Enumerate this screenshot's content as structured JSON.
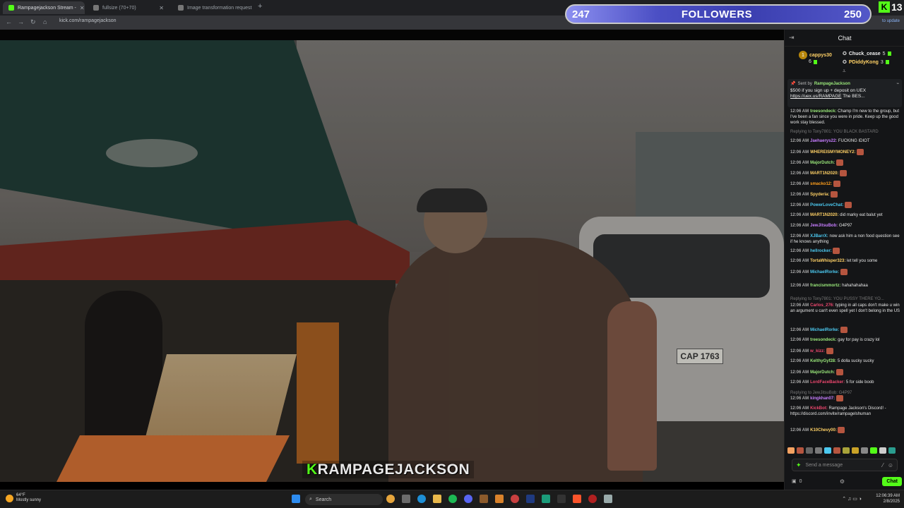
{
  "browser": {
    "tabs": [
      {
        "label": "Rampagejackson Stream - ",
        "active": true,
        "color": "#53fc18"
      },
      {
        "label": "fullsize (70+70)",
        "active": false,
        "color": "#777777"
      },
      {
        "label": "Image transformation request",
        "active": false,
        "color": "#777777"
      }
    ],
    "url": "kick.com/rampagejackson",
    "update_label": "to update"
  },
  "overlay": {
    "followers_left": "247",
    "followers_label": "FOLLOWERS",
    "followers_right": "250",
    "kick_count": "13",
    "watermark_k": "K",
    "watermark_name": "RAMPAGEJACKSON"
  },
  "chat": {
    "title": "Chat",
    "leaderboard": [
      {
        "name": "cappys30",
        "count": "6"
      },
      {
        "name": "Chuck_cease",
        "count": "5"
      },
      {
        "name": "PDiddyKong",
        "count": "3"
      }
    ],
    "pinned": {
      "sent_by": "Sent by",
      "sender": "RampageJackson",
      "message": "$500 if you sign up + deposit on UEX",
      "link": "https://uex.us/RAMPAGE",
      "suffix": "The BES..."
    },
    "messages": [
      {
        "time": "12:06 AM",
        "user": "treesondeck:",
        "color": "#9ae87a",
        "text": "Champ I'm new to the group, but I've been a fan since you were in pride. Keep up the good work stay blessed."
      },
      {
        "reply": "Replying to Tony7801: YOU BLACK BASTARD"
      },
      {
        "time": "12:06 AM",
        "user": "Jaehaerys22:",
        "color": "#c77dff",
        "text": "FUCKING IDIOT"
      },
      {
        "time": "12:06 AM",
        "user": "WHEREISMYMONEY2:",
        "color": "#ffd166",
        "text": ""
      },
      {
        "time": "12:06 AM",
        "user": "MajorDutch:",
        "color": "#9ae87a",
        "text": ""
      },
      {
        "time": "12:06 AM",
        "user": "MART1N2020:",
        "color": "#ffd166",
        "text": ""
      },
      {
        "time": "12:06 AM",
        "user": "smacko12:",
        "color": "#ff9f1c",
        "text": ""
      },
      {
        "time": "12:06 AM",
        "user": "Spyderia:",
        "color": "#ffd166",
        "text": ""
      },
      {
        "time": "12:06 AM",
        "user": "PowerLoveChat:",
        "color": "#4cc9f0",
        "text": ""
      },
      {
        "time": "12:06 AM",
        "user": "MART1N2020:",
        "color": "#ffd166",
        "text": "did marky eat balut yet"
      },
      {
        "time": "12:06 AM",
        "user": "JewJitsuBob:",
        "color": "#c77dff",
        "text": "G4P97"
      },
      {
        "time": "12:06 AM",
        "user": "XJBarrX:",
        "color": "#4cc9f0",
        "text": "now ask him a non food question see if he knows anything"
      },
      {
        "time": "12:06 AM",
        "user": "hellrocker:",
        "color": "#4cc9f0",
        "text": ""
      },
      {
        "time": "12:06 AM",
        "user": "TortaWhisper323:",
        "color": "#ffd166",
        "text": "let tell you some"
      },
      {
        "time": "12:06 AM",
        "user": "MichaelRorke:",
        "color": "#4cc9f0",
        "text": ""
      },
      {
        "time": "12:06 AM",
        "user": "francismmortz:",
        "color": "#9ae87a",
        "text": "hahahahahaa"
      },
      {
        "reply": "Replying to Tony7801: YOU PUSSY THERE YO..."
      },
      {
        "time": "12:06 AM",
        "user": "Carlos_276:",
        "color": "#ef476f",
        "text": "typing in all caps don't make u win an argument u can't even spell yet I don't belong in the US"
      },
      {
        "time": "12:06 AM",
        "user": "MichaelRorke:",
        "color": "#4cc9f0",
        "text": ""
      },
      {
        "time": "12:06 AM",
        "user": "treesondeck:",
        "color": "#9ae87a",
        "text": "gay for pay is crazy lol"
      },
      {
        "time": "12:06 AM",
        "user": "w_kizz:",
        "color": "#ef476f",
        "text": ""
      },
      {
        "time": "12:06 AM",
        "user": "KelthyGyf28:",
        "color": "#9ae87a",
        "text": "5 dolla sucky sucky"
      },
      {
        "time": "12:06 AM",
        "user": "MajorDutch:",
        "color": "#9ae87a",
        "text": ""
      },
      {
        "time": "12:06 AM",
        "user": "LordFaceBacker:",
        "color": "#ef476f",
        "text": "5 for side boob"
      },
      {
        "reply": "Replying to JewJitsuBob: G4P97"
      },
      {
        "time": "12:06 AM",
        "user": "kingkhan07:",
        "color": "#c77dff",
        "text": ""
      },
      {
        "time": "12:06 AM",
        "user": "KickBot:",
        "color": "#ef476f",
        "text": "Rampage Jackson's Discord! - https://discord.com/invite/rampagelshuman"
      },
      {
        "time": "12:06 AM",
        "user": "K10Chevy00:",
        "color": "#ffd166",
        "text": ""
      }
    ],
    "input_placeholder": "Send a message",
    "points": "0",
    "chat_button": "Chat"
  },
  "taskbar": {
    "temp": "64°F",
    "weather": "Mostly sunny",
    "search": "Search",
    "time": "12:06:39 AM",
    "date": "2/8/2025"
  }
}
